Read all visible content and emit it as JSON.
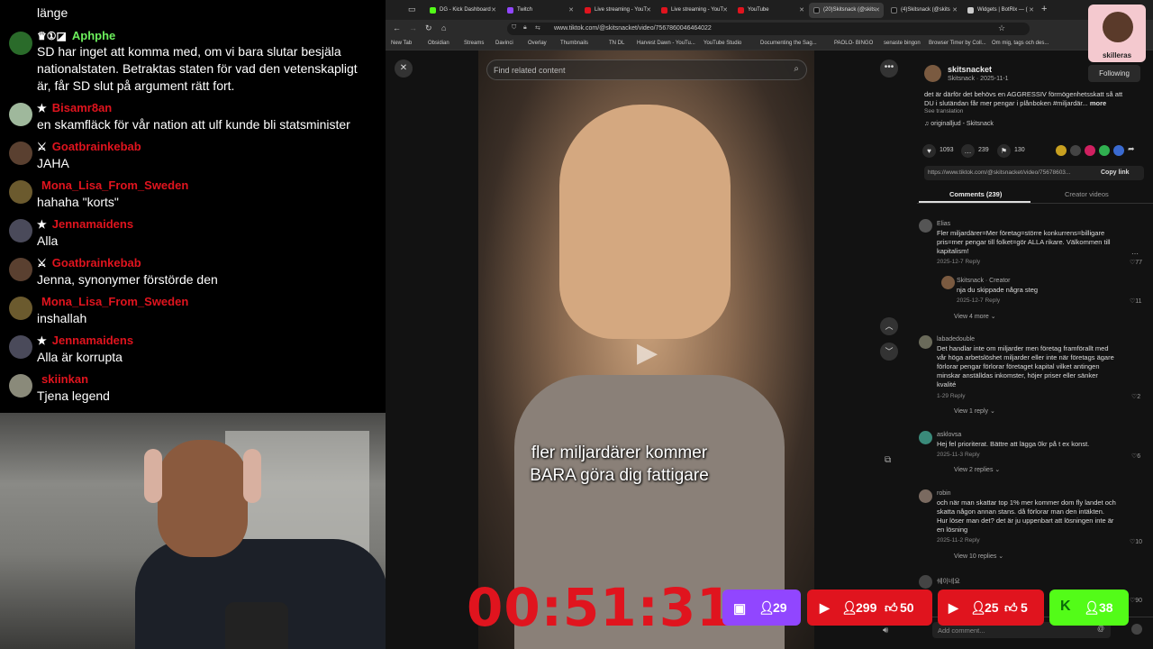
{
  "chat": {
    "messages": [
      {
        "user": "",
        "text": "länge",
        "color": "#ffffff"
      },
      {
        "user": "Aphphe",
        "text": "SD har inget att komma med, om vi bara slutar besjäla",
        "text2": "nationalstaten. Betraktas staten för vad den vetenskapligt",
        "text3": "är, får SD slut på argument rätt fort.",
        "color": "#6cf05c"
      },
      {
        "user": "Bisamr8an",
        "text": "en skamfläck för vår nation att ulf kunde bli statsminister",
        "color": "#e0141e"
      },
      {
        "user": "Goatbrainkebab",
        "text": "JAHA",
        "color": "#e0141e"
      },
      {
        "user": "Mona_Lisa_From_Sweden",
        "text": "hahaha \"korts\"",
        "color": "#e0141e"
      },
      {
        "user": "Jennamaidens",
        "text": "Alla",
        "color": "#e0141e"
      },
      {
        "user": "Goatbrainkebab",
        "text": "Jenna, synonymer förstörde den",
        "color": "#e0141e"
      },
      {
        "user": "Mona_Lisa_From_Sweden",
        "text": "inshallah",
        "color": "#e0141e"
      },
      {
        "user": "Jennamaidens",
        "text": "Alla är korrupta",
        "color": "#e0141e"
      },
      {
        "user": "skiinkan",
        "text": "Tjena legend",
        "color": "#e0141e"
      }
    ]
  },
  "browser": {
    "tabs": [
      "DG - Kick Dashboard",
      "Twitch",
      "Live streaming - YouT",
      "Live streaming - YouT",
      "YouTube",
      "(20)Skitsnack (@skits",
      "(4)Skitsnack (@skits",
      "Widgets | BotRix — ("
    ],
    "url": "www.tiktok.com/@skitsnacket/video/7567860046464022",
    "bookmarks": [
      "New Tab",
      "Obsidian",
      "Streams",
      "Davinci",
      "Overlay",
      "Thumbnails",
      "TN DL",
      "Harvest Dawn - YouTu...",
      "YouTube Studio",
      "Documenting the Sag...",
      "PAOLO- BINGO",
      "senaste bingon",
      "Browser Timer by Coll...",
      "Om mig, tags och des..."
    ]
  },
  "video": {
    "find_placeholder": "Find related content",
    "caption_line1": "fler miljardärer kommer",
    "caption_line2": "BARA göra dig fattigare"
  },
  "post": {
    "author": "skitsnacket",
    "handle_date": "Skitsnack · 2025-11-1",
    "follow_label": "Following",
    "description": "det är därför det behövs en AGGRESSIV förmögenhetsskatt så att DU i slutändan får mer pengar i plånboken #miljardär...",
    "more": "more",
    "see_translation": "See translation",
    "sound": "originalljud - Skitsnack",
    "likes": "1093",
    "comments": "239",
    "saves": "130",
    "link": "https://www.tiktok.com/@skitsnacket/video/75678603...",
    "copy_link": "Copy link",
    "tab_comments": "Comments (239)",
    "tab_creator": "Creator videos"
  },
  "comments": [
    {
      "user": "Elias",
      "text": "Fler miljardärer=Mer företag=större konkurrens=billigare pris=mer pengar till folket=gör ALLA rikare. Välkommen till kapitalism!",
      "date": "2025-12-7",
      "reply": "Reply",
      "likes": "77"
    },
    {
      "user": "Skitsnack · Creator",
      "text": "nja du skippade några steg",
      "date": "2025-12-7",
      "reply": "Reply",
      "likes": "11",
      "view": "View 4 more"
    },
    {
      "user": "labadedouble",
      "text": "Det handlar inte om miljarder men företag framförallt med vår höga arbetslöshet miljarder eller inte när företags ägare förlorar pengar förlorar företaget kapital vilket antingen minskar anställdas inkomster, höjer priser eller sänker kvalité",
      "date": "1-29",
      "reply": "Reply",
      "likes": "2",
      "view": "View 1 reply"
    },
    {
      "user": "asklovsa",
      "text": "Hej fel prioriterat. Bättre att lägga 0kr på t ex konst.",
      "date": "2025-11-3",
      "reply": "Reply",
      "likes": "6",
      "view": "View 2 replies"
    },
    {
      "user": "robin",
      "text": "och när man skattar top 1% mer kommer dom fly landet och skatta någon annan stans. då förlorar man den intäkten. Hur löser man det? det är ju uppenbart att lösningen inte är en lösning",
      "date": "2025-11-2",
      "reply": "Reply",
      "likes": "10",
      "view": "View 10 replies"
    },
    {
      "user": "쉐이네요",
      "text": "",
      "date": "",
      "reply": "",
      "likes": "90"
    }
  ],
  "add_comment": "Add comment...",
  "timer": "00:51:31",
  "stats": {
    "twitch": "29",
    "yt1_viewers": "299",
    "yt1_likes": "50",
    "yt2_viewers": "25",
    "yt2_likes": "5",
    "kick": "38"
  },
  "logo_text": "skilleras",
  "colors": {
    "twitch": "#9146ff",
    "youtube": "#e0141e",
    "kick": "#53fc18",
    "timer": "#e0141e"
  }
}
